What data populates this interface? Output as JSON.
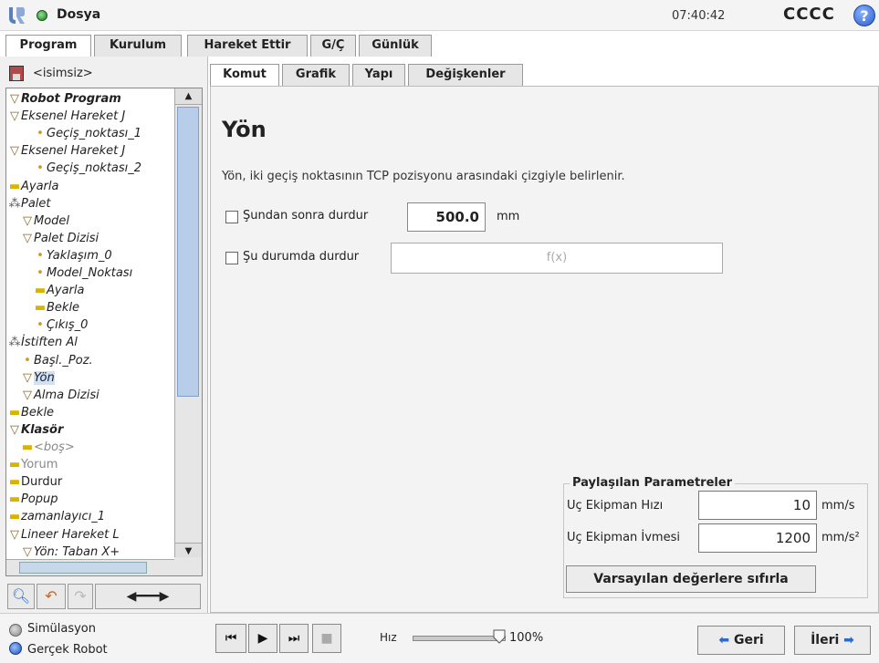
{
  "header": {
    "title": "Dosya",
    "time": "07:40:42",
    "robot_name": "CCCC",
    "help_icon": "?"
  },
  "main_tabs": [
    {
      "label": "Program"
    },
    {
      "label": "Kurulum"
    },
    {
      "label": "Hareket Ettir"
    },
    {
      "label": "G/Ç"
    },
    {
      "label": "Günlük"
    }
  ],
  "file": {
    "name": "<isimsiz>"
  },
  "tree": [
    {
      "label": "Robot Program",
      "glyph": "▽",
      "bold": true
    },
    {
      "label": "Eksenel Hareket J",
      "glyph": "▽"
    },
    {
      "label": "Geçiş_noktası_1",
      "glyph": "•"
    },
    {
      "label": "Eksenel Hareket J",
      "glyph": "▽"
    },
    {
      "label": "Geçiş_noktası_2",
      "glyph": "•"
    },
    {
      "label": "Ayarla",
      "glyph": "▬"
    },
    {
      "label": "Palet",
      "glyph": "⁂"
    },
    {
      "label": "Model",
      "glyph": "▽"
    },
    {
      "label": "Palet Dizisi",
      "glyph": "▽"
    },
    {
      "label": "Yaklaşım_0",
      "glyph": "•"
    },
    {
      "label": "Model_Noktası",
      "glyph": "•"
    },
    {
      "label": "Ayarla",
      "glyph": "▬"
    },
    {
      "label": "Bekle",
      "glyph": "▬"
    },
    {
      "label": "Çıkış_0",
      "glyph": "•"
    },
    {
      "label": "İstiften Al",
      "glyph": "⁂"
    },
    {
      "label": "Başl._Poz.",
      "glyph": "•"
    },
    {
      "label": "Yön",
      "glyph": "▽",
      "selected": true
    },
    {
      "label": "Alma Dizisi",
      "glyph": "▽"
    },
    {
      "label": "Bekle",
      "glyph": "▬"
    },
    {
      "label": "Klasör",
      "glyph": "▽",
      "bold": true
    },
    {
      "label": "<boş>",
      "glyph": "▬",
      "muted": true
    },
    {
      "label": "Yorum",
      "glyph": "▬",
      "muted": true,
      "upright": true
    },
    {
      "label": "Durdur",
      "glyph": "▬",
      "upright": true
    },
    {
      "label": "Popup",
      "glyph": "▬"
    },
    {
      "label": "zamanlayıcı_1",
      "glyph": "▬"
    },
    {
      "label": "Lineer Hareket L",
      "glyph": "▽"
    },
    {
      "label": "Yön: Taban X+",
      "glyph": "▽"
    }
  ],
  "right_tabs": [
    {
      "label": "Komut"
    },
    {
      "label": "Grafik"
    },
    {
      "label": "Yapı"
    },
    {
      "label": "Değişkenler"
    }
  ],
  "command": {
    "title": "Yön",
    "description": "Yön, iki geçiş noktasının TCP pozisyonu arasındaki çizgiyle belirlenir.",
    "stop_after_label": "Şundan sonra durdur",
    "stop_after_value": "500.0",
    "stop_after_unit": "mm",
    "stop_when_label": "Şu durumda durdur",
    "expression_placeholder": "f(x)"
  },
  "shared_params": {
    "title": "Paylaşılan Parametreler",
    "tool_speed_label": "Uç Ekipman Hızı",
    "tool_speed_value": "10",
    "tool_speed_unit": "mm/s",
    "tool_accel_label": "Uç Ekipman İvmesi",
    "tool_accel_value": "1200",
    "tool_accel_unit": "mm/s²",
    "reset_label": "Varsayılan değerlere sıfırla"
  },
  "footer": {
    "simulation_label": "Simülasyon",
    "real_robot_label": "Gerçek Robot",
    "speed_label": "Hız",
    "speed_value": "100%",
    "speed_fraction": 1.0,
    "back_label": "Geri",
    "next_label": "İleri"
  }
}
